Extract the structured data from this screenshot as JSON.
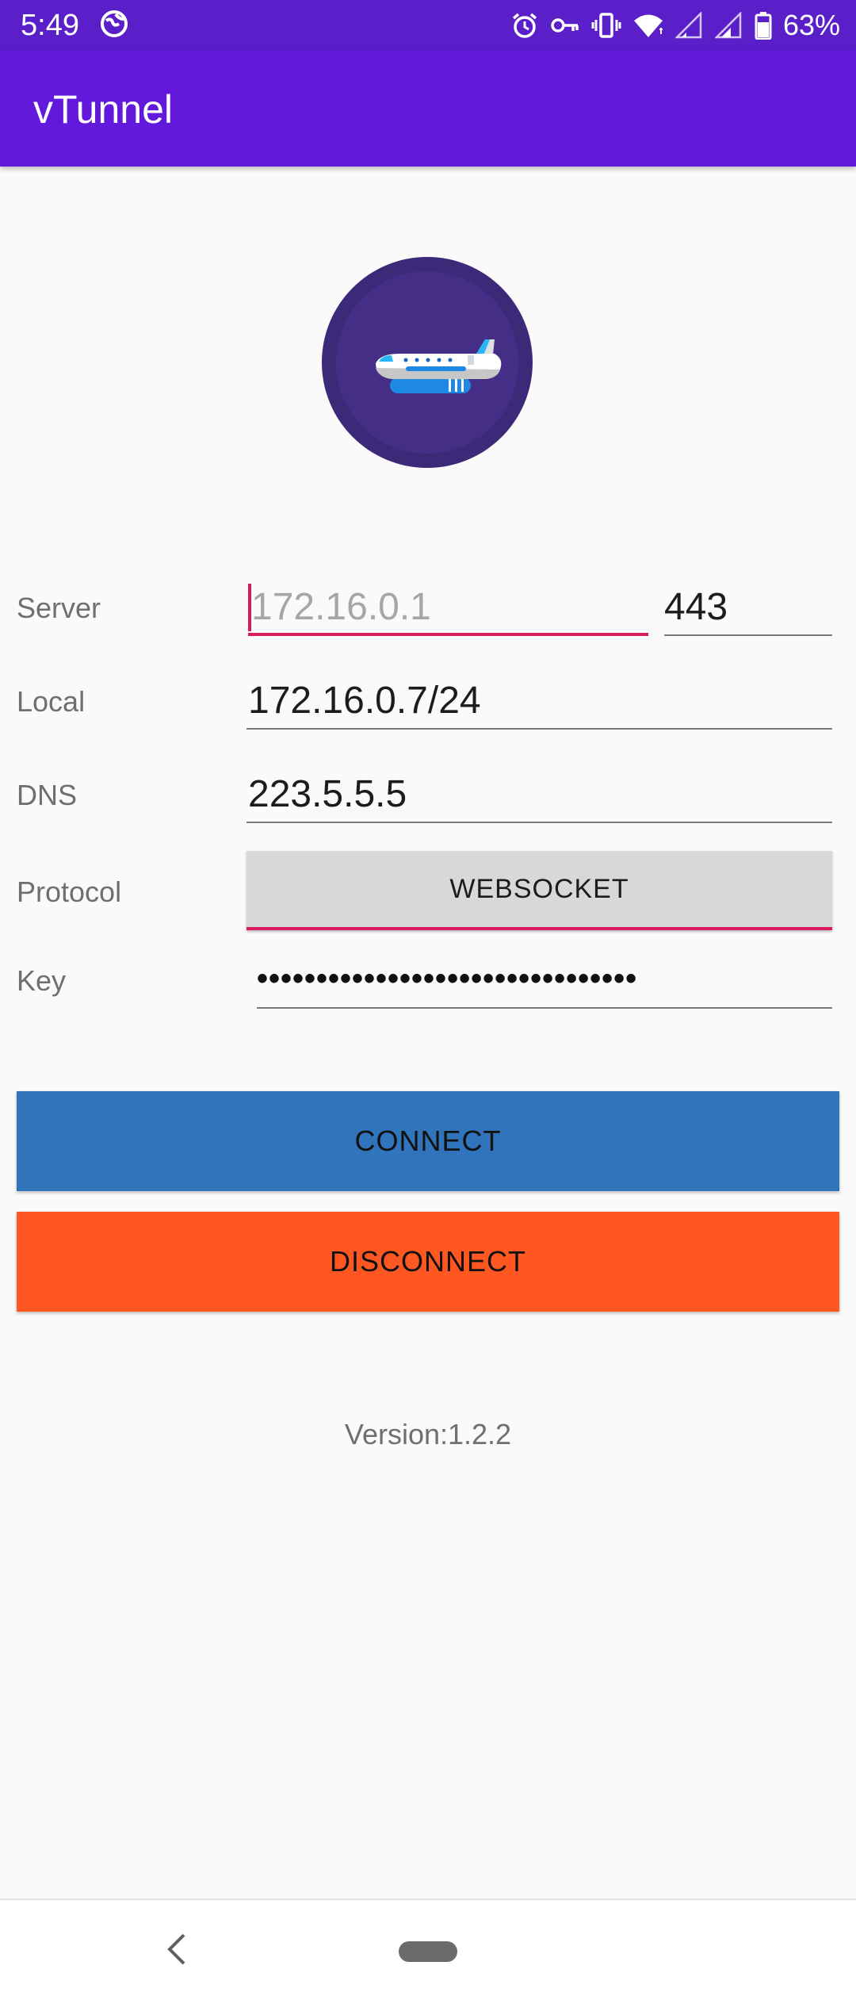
{
  "status_bar": {
    "time": "5:49",
    "battery": "63%",
    "icons": [
      "globe-icon",
      "alarm-icon",
      "vpn-key-icon",
      "vibrate-icon",
      "wifi-icon",
      "signal-icon",
      "signal-icon",
      "battery-icon"
    ]
  },
  "toolbar": {
    "title": "vTunnel"
  },
  "form": {
    "server": {
      "label": "Server",
      "placeholder": "172.16.0.1",
      "port": "443"
    },
    "local": {
      "label": "Local",
      "value": "172.16.0.7/24"
    },
    "dns": {
      "label": "DNS",
      "value": "223.5.5.5"
    },
    "protocol": {
      "label": "Protocol",
      "value": "WEBSOCKET"
    },
    "key": {
      "label": "Key",
      "masked": "••••••••••••••••••••••••••••••••"
    }
  },
  "actions": {
    "connect_label": "CONNECT",
    "disconnect_label": "DISCONNECT"
  },
  "footer": {
    "version": "Version:1.2.2"
  },
  "colors": {
    "status_bar": "#5a1fc9",
    "toolbar": "#6219dc",
    "accent": "#d81b60",
    "connect": "#3074bc",
    "disconnect": "#ff5722",
    "logo_circle": "#3c2a79"
  }
}
